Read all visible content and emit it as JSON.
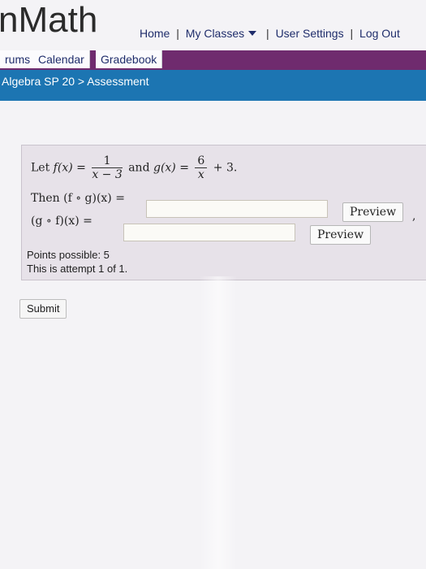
{
  "header": {
    "logo": "nMath",
    "nav": {
      "home": "Home",
      "sep1": "|",
      "my_classes": "My Classes",
      "sep2": "|",
      "user_settings": "User Settings",
      "sep3": "|",
      "logout": "Log Out"
    }
  },
  "tabs": [
    "rums",
    "Calendar",
    "Gradebook"
  ],
  "breadcrumb": "Algebra SP 20 > Assessment",
  "question": {
    "line1": {
      "let": "Let",
      "f_of_x": "f(x) =",
      "f_num": "1",
      "f_den": "x − 3",
      "and": "and",
      "g_of_x": "g(x) =",
      "g_num": "6",
      "g_den": "x",
      "g_tail": "+ 3."
    },
    "line2_label": "Then (f ∘ g)(x) =",
    "line3_label": "(g ∘ f)(x) =",
    "answer1_value": "",
    "answer2_value": "",
    "preview_label": "Preview",
    "stray_comma": ","
  },
  "points": {
    "possible": "Points possible: 5",
    "attempt": "This is attempt 1 of 1."
  },
  "submit_label": "Submit",
  "colors": {
    "tab_bar": "#6f2b6e",
    "breadcrumb_bar": "#1c75b2",
    "question_bg": "#e7e2e9",
    "nav_link": "#1f2d6b"
  },
  "icons": {
    "my_classes_dropdown": "caret-down-icon"
  }
}
